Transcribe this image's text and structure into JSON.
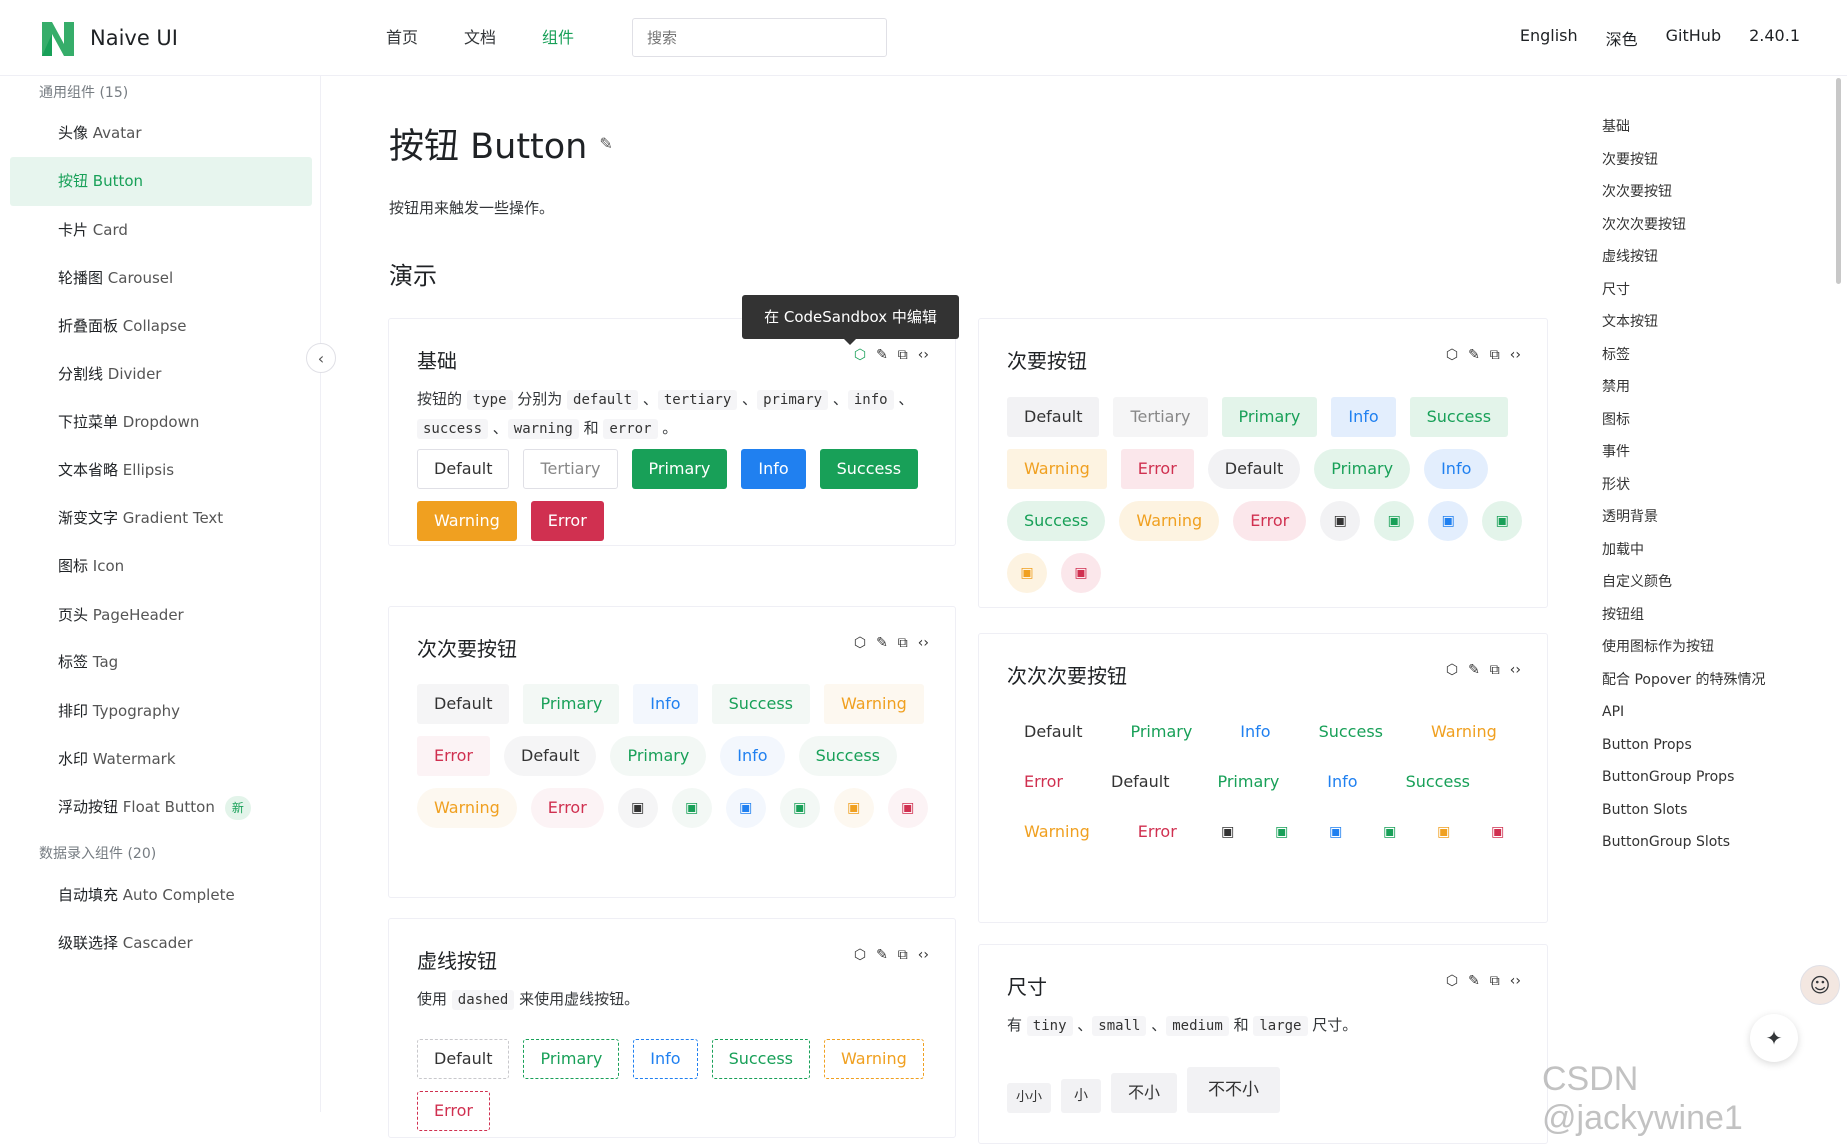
{
  "header": {
    "logo_text": "Naive UI",
    "nav": [
      "首页",
      "文档",
      "组件"
    ],
    "active_nav": "组件",
    "search_placeholder": "搜索",
    "right": [
      "English",
      "深色",
      "GitHub",
      "2.40.1"
    ]
  },
  "sidebar": {
    "groups": [
      {
        "title": "通用组件 (15)",
        "items": [
          {
            "zh": "头像",
            "en": "Avatar"
          },
          {
            "zh": "按钮",
            "en": "Button",
            "active": true
          },
          {
            "zh": "卡片",
            "en": "Card"
          },
          {
            "zh": "轮播图",
            "en": "Carousel"
          },
          {
            "zh": "折叠面板",
            "en": "Collapse"
          },
          {
            "zh": "分割线",
            "en": "Divider"
          },
          {
            "zh": "下拉菜单",
            "en": "Dropdown"
          },
          {
            "zh": "文本省略",
            "en": "Ellipsis"
          },
          {
            "zh": "渐变文字",
            "en": "Gradient Text"
          },
          {
            "zh": "图标",
            "en": "Icon"
          },
          {
            "zh": "页头",
            "en": "PageHeader"
          },
          {
            "zh": "标签",
            "en": "Tag"
          },
          {
            "zh": "排印",
            "en": "Typography"
          },
          {
            "zh": "水印",
            "en": "Watermark"
          },
          {
            "zh": "浮动按钮",
            "en": "Float Button",
            "badge": "新"
          }
        ]
      },
      {
        "title": "数据录入组件 (20)",
        "items": [
          {
            "zh": "自动填充",
            "en": "Auto Complete"
          },
          {
            "zh": "级联选择",
            "en": "Cascader"
          }
        ]
      }
    ]
  },
  "main": {
    "title": "按钮 Button",
    "desc": "按钮用来触发一些操作。",
    "demo_heading": "演示",
    "tooltip": "在 CodeSandbox 中编辑"
  },
  "cards": {
    "basic": {
      "title": "基础",
      "desc_parts": [
        "按钮的 ",
        "type",
        " 分别为 ",
        "default",
        " 、",
        "tertiary",
        " 、",
        "primary",
        " 、",
        "info",
        " 、",
        "success",
        " 、",
        "warning",
        " 和 ",
        "error",
        " 。"
      ],
      "buttons": [
        "Default",
        "Tertiary",
        "Primary",
        "Info",
        "Success",
        "Warning",
        "Error"
      ]
    },
    "secondary": {
      "title": "次要按钮",
      "buttons": [
        "Default",
        "Tertiary",
        "Primary",
        "Info",
        "Success",
        "Warning",
        "Error",
        "Default",
        "Primary",
        "Info",
        "Success",
        "Warning",
        "Error"
      ]
    },
    "tertiary": {
      "title": "次次要按钮",
      "buttons": [
        "Default",
        "Primary",
        "Info",
        "Success",
        "Warning",
        "Error",
        "Default",
        "Primary",
        "Info",
        "Success",
        "Warning",
        "Error"
      ]
    },
    "quaternary": {
      "title": "次次次要按钮",
      "buttons": [
        "Default",
        "Primary",
        "Info",
        "Success",
        "Warning",
        "Error",
        "Default",
        "Primary",
        "Info",
        "Success",
        "Warning",
        "Error"
      ]
    },
    "dashed": {
      "title": "虚线按钮",
      "desc_before": "使用 ",
      "desc_code": "dashed",
      "desc_after": " 来使用虚线按钮。",
      "buttons": [
        "Default",
        "Primary",
        "Info",
        "Success",
        "Warning",
        "Error"
      ]
    },
    "size": {
      "title": "尺寸",
      "desc_parts": [
        "有 ",
        "tiny",
        " 、",
        "small",
        " 、",
        "medium",
        " 和 ",
        "large",
        " 尺寸。"
      ],
      "buttons": [
        "小小",
        "小",
        "不小",
        "不不小"
      ]
    }
  },
  "toc": [
    "基础",
    "次要按钮",
    "次次要按钮",
    "次次次要按钮",
    "虚线按钮",
    "尺寸",
    "文本按钮",
    "标签",
    "禁用",
    "图标",
    "事件",
    "形状",
    "透明背景",
    "加载中",
    "自定义颜色",
    "按钮组",
    "使用图标作为按钮",
    "配合 Popover 的特殊情况",
    "API",
    "Button Props",
    "ButtonGroup Props",
    "Button Slots",
    "ButtonGroup Slots"
  ],
  "watermark": "CSDN @jackywine1",
  "colors": {
    "primary": "#18a058",
    "info": "#2080f0",
    "warning": "#f0a020",
    "error": "#d03050"
  },
  "icons": [
    "cube-icon",
    "edit-icon",
    "copy-icon",
    "code-icon",
    "cash-icon",
    "chevron-left-icon",
    "magic-wand-icon"
  ]
}
